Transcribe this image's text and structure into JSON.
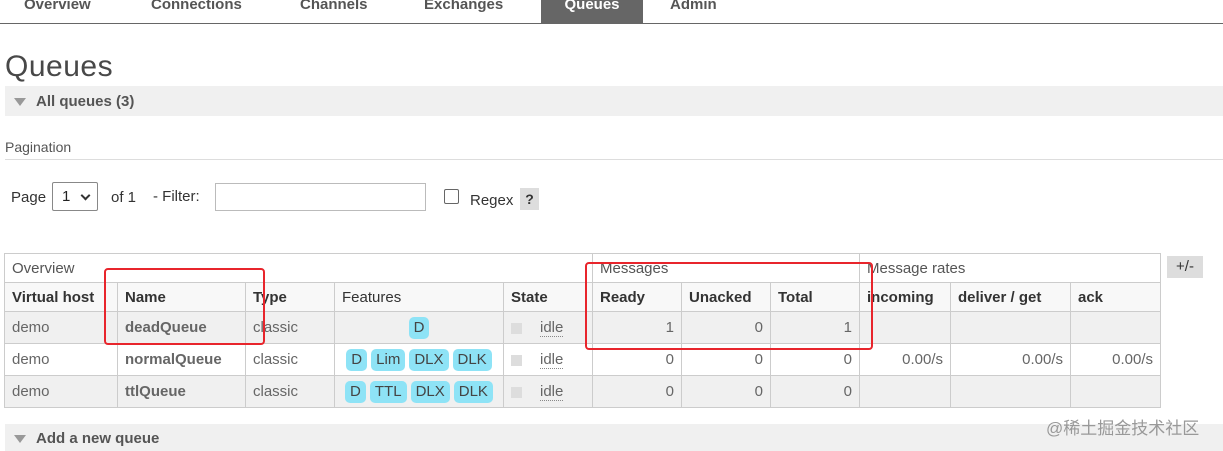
{
  "tabs": [
    {
      "label": "Overview",
      "active": false
    },
    {
      "label": "Connections",
      "active": false
    },
    {
      "label": "Channels",
      "active": false
    },
    {
      "label": "Exchanges",
      "active": false
    },
    {
      "label": "Queues",
      "active": true
    },
    {
      "label": "Admin",
      "active": false
    }
  ],
  "page_title": "Queues",
  "all_queues": {
    "label": "All queues (3)"
  },
  "pagination": {
    "label": "Pagination",
    "page_label": "Page",
    "page_value": "1",
    "of_label": "of 1",
    "filter_label": "- Filter:",
    "filter_value": "",
    "regex_label": "Regex",
    "help_label": "?"
  },
  "table": {
    "groups": {
      "overview": "Overview",
      "messages": "Messages",
      "rates": "Message rates"
    },
    "columns": [
      "Virtual host",
      "Name",
      "Type",
      "Features",
      "State",
      "Ready",
      "Unacked",
      "Total",
      "incoming",
      "deliver / get",
      "ack"
    ],
    "plus_minus": "+/-",
    "rows": [
      {
        "vhost": "demo",
        "name": "deadQueue",
        "type": "classic",
        "features": [
          "D"
        ],
        "state": "idle",
        "ready": "1",
        "unacked": "0",
        "total": "1",
        "incoming": "",
        "deliver": "",
        "ack": ""
      },
      {
        "vhost": "demo",
        "name": "normalQueue",
        "type": "classic",
        "features": [
          "D",
          "Lim",
          "DLX",
          "DLK"
        ],
        "state": "idle",
        "ready": "0",
        "unacked": "0",
        "total": "0",
        "incoming": "0.00/s",
        "deliver": "0.00/s",
        "ack": "0.00/s"
      },
      {
        "vhost": "demo",
        "name": "ttlQueue",
        "type": "classic",
        "features": [
          "D",
          "TTL",
          "DLX",
          "DLK"
        ],
        "state": "idle",
        "ready": "0",
        "unacked": "0",
        "total": "0",
        "incoming": "",
        "deliver": "",
        "ack": ""
      }
    ]
  },
  "add_queue": {
    "label": "Add a new queue"
  },
  "watermark": "@稀土掘金技术社区",
  "colors": {
    "tab_active": "#666666",
    "feature_badge": "#8ee3f6",
    "highlight": "#e8252c"
  }
}
